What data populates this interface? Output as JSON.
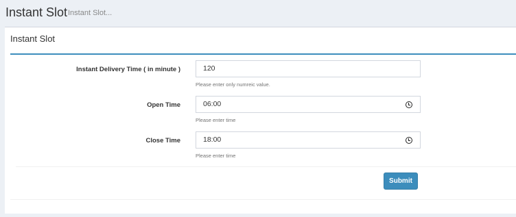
{
  "header": {
    "title": "Instant Slot",
    "subtitle": "Instant Slot..."
  },
  "box": {
    "title": "Instant Slot"
  },
  "form": {
    "delivery": {
      "label": "Instant Delivery Time ( in minute )",
      "value": "120",
      "help": "Please enter only numreic value."
    },
    "open": {
      "label": "Open Time",
      "value": "06:00",
      "icon": "clock-icon",
      "help": "Please enter time"
    },
    "close": {
      "label": "Close Time",
      "value": "18:00",
      "icon": "clock-icon",
      "help": "Please enter time"
    },
    "submit_label": "Submit"
  },
  "colors": {
    "accent": "#3c8dbc",
    "background": "#ecf0f5"
  }
}
